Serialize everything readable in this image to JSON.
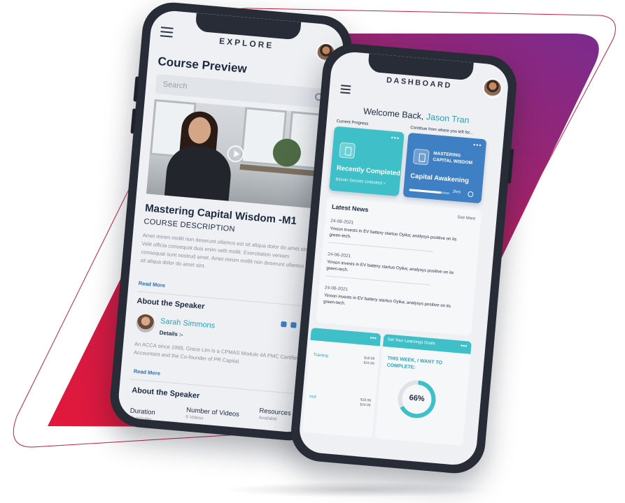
{
  "colors": {
    "backdrop_red": "#e3183b",
    "backdrop_purple": "#7b2b8f",
    "accent_teal": "#3fc0c9",
    "accent_blue": "#3f7fc3",
    "phone_frame": "#272c36"
  },
  "left_phone": {
    "nav_title": "EXPLORE",
    "heading": "Course Preview",
    "search_placeholder": "Search",
    "course_title": "Mastering Capital Wisdom -M1",
    "course_subtitle": "COURSE DESCRIPTION",
    "description": "Amet minim mollit non deserunt ullamco est sit aliqua dolor do amet sint. Velit officia consequat duis enim velit mollit. Exercitation veniam consequat sunt nostrud amet. Amet minim mollit non deserunt ullamco est sit aliqua dolor do amet sint.",
    "read_more": "Read More",
    "about_speaker": "About the Speaker",
    "speaker_name": "Sarah Simmons",
    "speaker_details": "Details :-",
    "speaker_bio": "An ACCA since 1998, Grace Lim is a CPMAS Module 4A PMC Certified Accountant and the Co-founder of PR Capital.",
    "read_more_2": "Read More",
    "about_speaker_2": "About the Speaker",
    "stats": [
      {
        "label": "Duration",
        "sub": "15 minutes"
      },
      {
        "label": "Number of Videos",
        "sub": "6 Videos"
      },
      {
        "label": "Resources",
        "sub": "Available"
      }
    ]
  },
  "right_phone": {
    "nav_title": "DASHBOARD",
    "welcome": "Welcome Back,",
    "user_name": "Jason Tran",
    "current_progress_label": "Current Progress",
    "continue_label": "Contibue from where you left for...",
    "card_completed": {
      "title": "Recently Completed",
      "subtitle": "Bitcoin Secrets Unlocked ✓"
    },
    "card_continue": {
      "course": "MASTERING CAPITAL WISDOM",
      "title": "Capital Awakening",
      "progress": 0.8,
      "time": "2hrs"
    },
    "news": {
      "title": "Latest News",
      "see_more": "See More",
      "items": [
        {
          "date": "24-06-2021",
          "text": "Yinson invests in EV battery startuo Oyika; analysys positive on its green-tech."
        },
        {
          "date": "24-06-2021",
          "text": "Yinson invests in EV battery startuo Oyika; analysys positive on its green-tech."
        },
        {
          "date": "24-06-2021",
          "text": "Yinson invests in EV battery startuo Oyika; analysys positive on its green-tech."
        }
      ]
    },
    "mini_left": {
      "row1": "Training",
      "price1": "$18.99",
      "price1b": "$24.99",
      "row2": "nce",
      "price2": "$18.99",
      "price2b": "$24.99"
    },
    "goals": {
      "title": "Set Your Learnings Goals",
      "prompt": "THIS WEEK, I WANT TO COMPLETE:",
      "percent": "66%"
    }
  }
}
